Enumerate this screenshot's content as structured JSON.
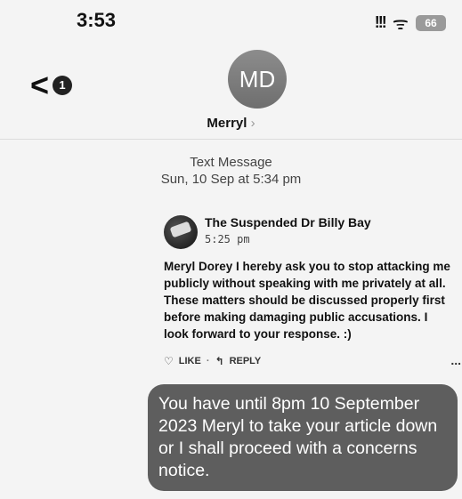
{
  "status_bar": {
    "time": "3:53",
    "signal": "!!!",
    "wifi": "ᯤ",
    "battery": "66"
  },
  "header": {
    "back_badge": "1",
    "avatar_initials": "MD",
    "contact_name": "Merryl",
    "contact_chevron": "›"
  },
  "meta": {
    "kind": "Text Message",
    "date": "Sun, 10 Sep at 5:34 pm"
  },
  "quoted_post": {
    "author": "The Suspended Dr Billy Bay",
    "time": "5:25 pm",
    "body": "Meryl Dorey I hereby ask you to stop attacking me publicly without speaking with me privately at all. These matters should be discussed properly first before making damaging public accusations. I look forward to your response. :)",
    "like_label": "LIKE",
    "separator": "·",
    "reply_label": "REPLY",
    "more": "..."
  },
  "message": {
    "text": "You have until 8pm 10 September 2023 Meryl to take your article down or I shall proceed with a concerns notice."
  },
  "icons": {
    "back": "chevron-left-icon",
    "like": "heart-icon",
    "reply": "reply-icon",
    "more": "more-icon"
  },
  "colors": {
    "bubble": "#5e5e5e",
    "avatar": "#7d7d7d",
    "background": "#f4f4f4"
  }
}
